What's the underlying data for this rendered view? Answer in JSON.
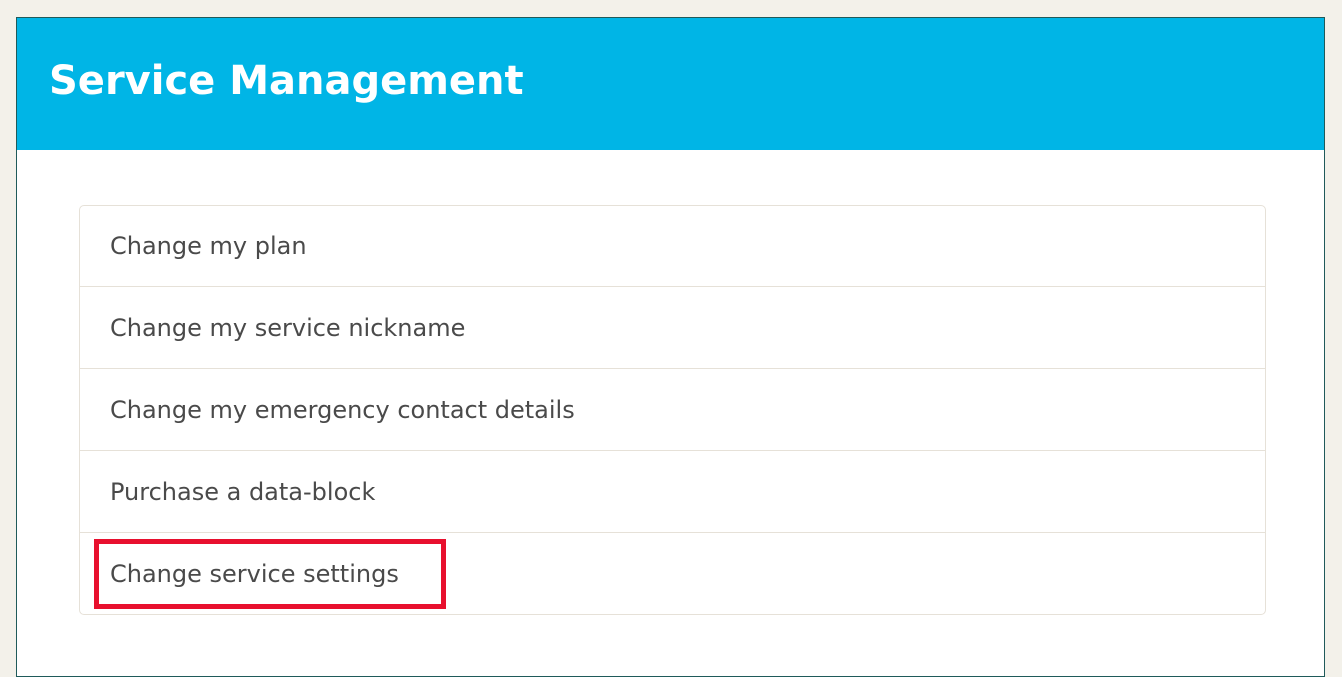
{
  "panel": {
    "title": "Service Management"
  },
  "menu": {
    "items": [
      {
        "label": "Change my plan"
      },
      {
        "label": "Change my service nickname"
      },
      {
        "label": "Change my emergency contact details"
      },
      {
        "label": "Purchase a data-block"
      },
      {
        "label": "Change service settings",
        "highlighted": true
      }
    ]
  },
  "colors": {
    "header": "#00b5e6",
    "highlight": "#e8102e",
    "page_background": "#f3f1ea"
  }
}
